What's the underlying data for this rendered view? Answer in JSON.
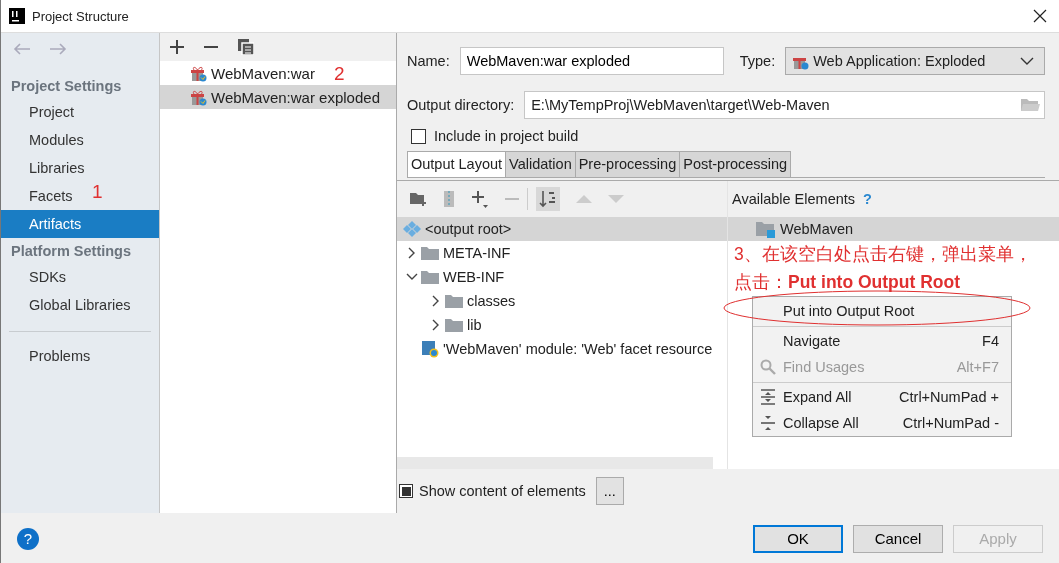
{
  "window": {
    "title": "Project Structure"
  },
  "sidebar": {
    "sections": [
      {
        "heading": "Project Settings",
        "items": [
          {
            "label": "Project",
            "selected": false
          },
          {
            "label": "Modules",
            "selected": false
          },
          {
            "label": "Libraries",
            "selected": false
          },
          {
            "label": "Facets",
            "selected": false
          },
          {
            "label": "Artifacts",
            "selected": true
          }
        ]
      },
      {
        "heading": "Platform Settings",
        "items": [
          {
            "label": "SDKs",
            "selected": false
          },
          {
            "label": "Global Libraries",
            "selected": false
          }
        ]
      }
    ],
    "extra_items": [
      {
        "label": "Problems",
        "selected": false
      }
    ]
  },
  "artifacts": {
    "items": [
      {
        "label": "WebMaven:war",
        "selected": false
      },
      {
        "label": "WebMaven:war exploded",
        "selected": true
      }
    ]
  },
  "editor": {
    "name_label": "Name:",
    "name_value": "WebMaven:war exploded",
    "type_label": "Type:",
    "type_value": "Web Application: Exploded",
    "output_dir_label": "Output directory:",
    "output_dir_value": "E:\\MyTempProj\\WebMaven\\target\\Web-Maven",
    "include_checkbox": {
      "label": "Include in project build",
      "checked": false
    },
    "tabs": [
      {
        "label": "Output Layout",
        "selected": true
      },
      {
        "label": "Validation",
        "selected": false
      },
      {
        "label": "Pre-processing",
        "selected": false
      },
      {
        "label": "Post-processing",
        "selected": false
      }
    ],
    "layout_tree": [
      {
        "label": "<output root>",
        "kind": "root",
        "selected": true
      },
      {
        "label": "META-INF",
        "kind": "folder",
        "selected": false,
        "expanded": false
      },
      {
        "label": "WEB-INF",
        "kind": "folder",
        "selected": false,
        "expanded": true,
        "children": [
          {
            "label": "classes",
            "kind": "folder",
            "selected": false,
            "expanded": false
          },
          {
            "label": "lib",
            "kind": "folder",
            "selected": false,
            "expanded": false
          }
        ]
      },
      {
        "label": "'WebMaven' module: 'Web' facet resource",
        "kind": "module",
        "selected": false
      }
    ],
    "available_heading": "Available Elements",
    "help_mark": "?",
    "available_items": [
      {
        "label": "WebMaven",
        "selected": true
      }
    ],
    "show_content": {
      "label": "Show content of elements",
      "checked": true
    },
    "more_button": "..."
  },
  "context_menu": [
    {
      "label": "Put into Output Root",
      "kind": "plain",
      "disabled": false
    },
    {
      "label": "Navigate",
      "shortcut": "F4",
      "kind": "plain",
      "disabled": false,
      "separator_before": true
    },
    {
      "label": "Find Usages",
      "shortcut": "Alt+F7",
      "kind": "search",
      "disabled": true
    },
    {
      "label": "Expand All",
      "shortcut": "Ctrl+NumPad +",
      "kind": "expand",
      "disabled": false,
      "separator_before": true
    },
    {
      "label": "Collapse All",
      "shortcut": "Ctrl+NumPad -",
      "kind": "collapse",
      "disabled": false
    }
  ],
  "annotations": [
    {
      "text": "1"
    },
    {
      "text": "2"
    },
    {
      "text": "3、在该空白处点击右键，弹出菜单，点击：**Put into Output Root**"
    }
  ],
  "buttons": [
    {
      "label": "OK",
      "kind": "primary",
      "disabled": false
    },
    {
      "label": "Cancel",
      "kind": "normal",
      "disabled": false
    },
    {
      "label": "Apply",
      "kind": "normal",
      "disabled": true
    }
  ],
  "help_button": "?"
}
